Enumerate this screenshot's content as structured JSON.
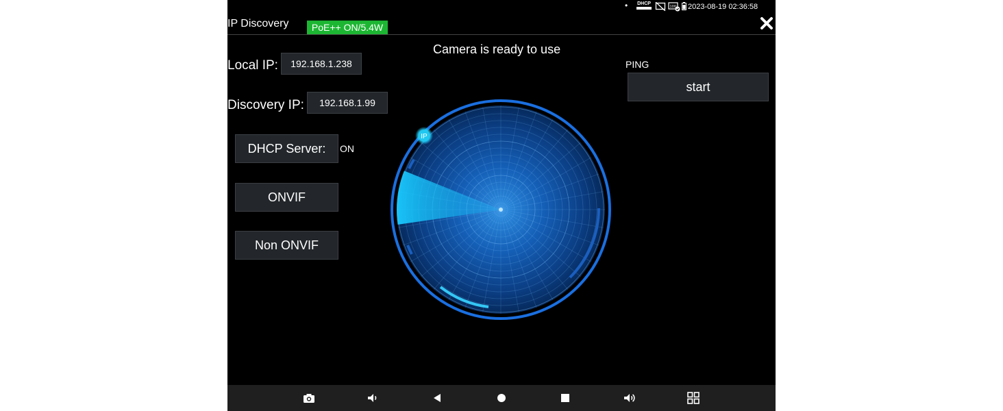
{
  "statusbar": {
    "dot": "•",
    "dhcp_label": "DHCP",
    "icons": [
      "dhcp-icon",
      "no-display-icon",
      "network-check-icon",
      "battery-icon"
    ],
    "datetime": "2023-08-19 02:36:58"
  },
  "header": {
    "title": "IP Discovery",
    "poe_badge": "PoE++ ON/5.4W",
    "poe_color": "#1db633",
    "close_icon": "close-icon"
  },
  "main": {
    "status_message": "Camera is ready to use",
    "local_ip_label": "Local IP:",
    "local_ip_value": "192.168.1.238",
    "discovery_ip_label": "Discovery IP:",
    "discovery_ip_value": "192.168.1.99",
    "dhcp_button_label": "DHCP Server:",
    "dhcp_state": "ON",
    "onvif_button_label": "ONVIF",
    "non_onvif_button_label": "Non ONVIF",
    "ping_label": "PING",
    "start_button_label": "start",
    "radar_marker_label": "IP",
    "accent_color": "#1a6fe0"
  },
  "navbar": {
    "icons": [
      "camera-icon",
      "volume-down-icon",
      "back-icon",
      "home-icon",
      "recents-icon",
      "volume-up-icon",
      "apps-grid-icon"
    ]
  }
}
